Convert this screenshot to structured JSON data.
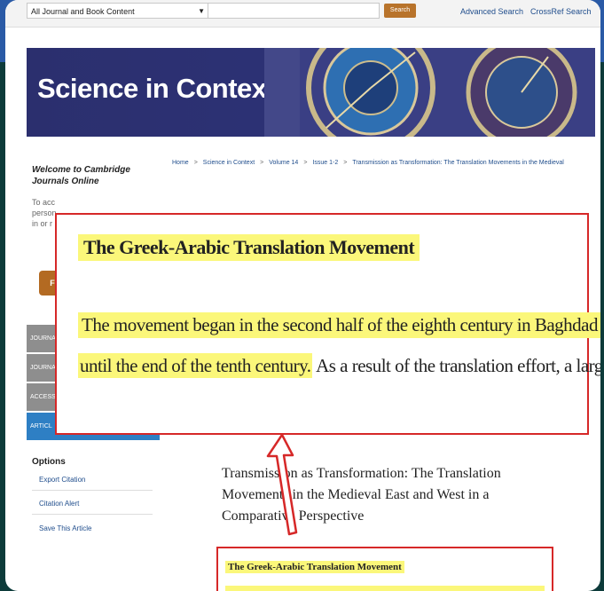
{
  "search_bar": {
    "scope_select": "All Journal and Book Content",
    "search_button": "Search",
    "advanced_search": "Advanced Search",
    "crossref_search": "CrossRef Search"
  },
  "banner": {
    "title": "Science in Context"
  },
  "sidebar": {
    "welcome": "Welcome to Cambridge Journals Online",
    "intro_lines": [
      "To acc",
      "person",
      "in or r"
    ],
    "orange_button": "F",
    "tabs": [
      "JOURNA",
      "JOURNA",
      "ACCESS",
      "ARTICL"
    ],
    "options_title": "Options",
    "options": [
      "Export Citation",
      "Citation Alert",
      "Save This Article"
    ]
  },
  "breadcrumb": {
    "items": [
      "Home",
      "Science in Context",
      "Volume 14",
      "Issue 1-2",
      "Transmission as Transformation: The Translation Movements in the Medieval"
    ],
    "separator": ">"
  },
  "article": {
    "title": "Transmission as Transformation: The Translation Movements in the Medieval East and West in a Comparative Perspective"
  },
  "zoom_callout": {
    "heading": "The Greek-Arabic Translation Movement",
    "line1": "The movement began in the second half of the eighth century in Baghdad and lasted",
    "line2_highlight": "until the end of the tenth century.",
    "line2_rest": " As a result of the translation effort, a large corpus"
  },
  "bottom_callout": {
    "heading": "The Greek-Arabic Translation Movement"
  },
  "colors": {
    "highlight": "#fbf77a",
    "callout_border": "#d62828",
    "banner": "#2b2f6e",
    "link": "#1f4d8c"
  }
}
